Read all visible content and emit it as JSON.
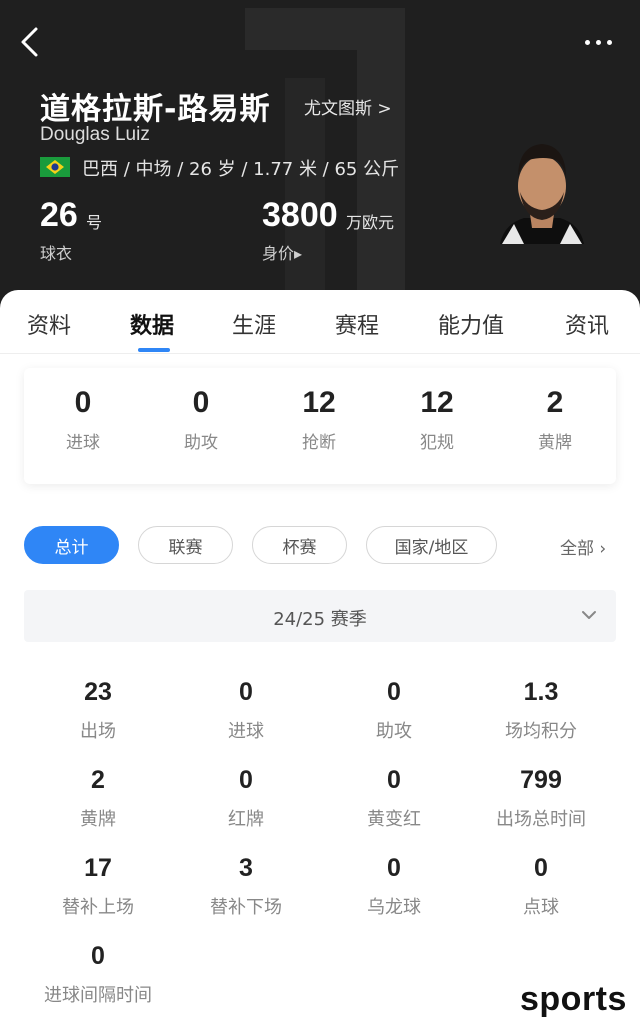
{
  "header": {
    "player_name_cn": "道格拉斯-路易斯",
    "team_link": "尤文图斯 >",
    "player_name_en": "Douglas Luiz",
    "info_line": "巴西 / 中场 / 26 岁 / 1.77 米 / 65 公斤",
    "jersey_number": "26",
    "jersey_unit": "号",
    "jersey_label": "球衣",
    "market_value": "3800",
    "market_value_unit": "万欧元",
    "market_value_label": "身价▸",
    "bg_color": "#1f1f1f"
  },
  "tabs": [
    {
      "label": "资料"
    },
    {
      "label": "数据"
    },
    {
      "label": "生涯"
    },
    {
      "label": "赛程"
    },
    {
      "label": "能力值"
    },
    {
      "label": "资讯"
    }
  ],
  "active_tab": "数据",
  "summary": [
    {
      "value": "0",
      "label": "进球"
    },
    {
      "value": "0",
      "label": "助攻"
    },
    {
      "value": "12",
      "label": "抢断"
    },
    {
      "value": "12",
      "label": "犯规"
    },
    {
      "value": "2",
      "label": "黄牌"
    }
  ],
  "filters": {
    "chips": [
      {
        "label": "总计"
      },
      {
        "label": "联赛"
      },
      {
        "label": "杯赛"
      },
      {
        "label": "国家/地区"
      }
    ],
    "all_label": "全部 ›",
    "accent_color": "#2f86f6"
  },
  "season": {
    "label": "24/25 赛季"
  },
  "stats": [
    {
      "value": "23",
      "label": "出场"
    },
    {
      "value": "0",
      "label": "进球"
    },
    {
      "value": "0",
      "label": "助攻"
    },
    {
      "value": "1.3",
      "label": "场均积分"
    },
    {
      "value": "2",
      "label": "黄牌"
    },
    {
      "value": "0",
      "label": "红牌"
    },
    {
      "value": "0",
      "label": "黄变红"
    },
    {
      "value": "799",
      "label": "出场总时间"
    },
    {
      "value": "17",
      "label": "替补上场"
    },
    {
      "value": "3",
      "label": "替补下场"
    },
    {
      "value": "0",
      "label": "乌龙球"
    },
    {
      "value": "0",
      "label": "点球"
    },
    {
      "value": "0",
      "label": "进球间隔时间"
    }
  ],
  "watermark": "sports"
}
